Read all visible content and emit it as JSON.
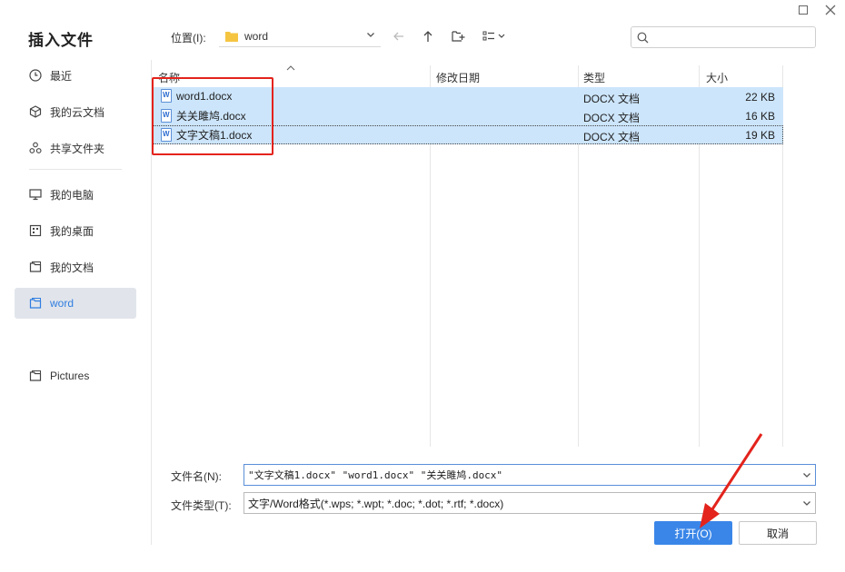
{
  "dialog": {
    "title": "插入文件"
  },
  "sidebar": {
    "items": [
      {
        "label": "最近",
        "icon": "clock-icon"
      },
      {
        "label": "我的云文档",
        "icon": "cloud-doc-icon"
      },
      {
        "label": "共享文件夹",
        "icon": "share-icon"
      },
      {
        "label": "我的电脑",
        "icon": "monitor-icon"
      },
      {
        "label": "我的桌面",
        "icon": "desktop-icon"
      },
      {
        "label": "我的文档",
        "icon": "folder-icon"
      },
      {
        "label": "word",
        "icon": "folder-icon"
      },
      {
        "label": "Pictures",
        "icon": "folder-icon"
      }
    ],
    "active_index": 6
  },
  "toolbar": {
    "location_label": "位置(I):",
    "location_value": "word",
    "search_placeholder": ""
  },
  "list": {
    "columns": [
      "名称",
      "修改日期",
      "类型",
      "大小"
    ],
    "rows": [
      {
        "name": "word1.docx",
        "type": "DOCX 文档",
        "size": "22 KB"
      },
      {
        "name": "关关雎鸠.docx",
        "type": "DOCX 文档",
        "size": "16 KB"
      },
      {
        "name": "文字文稿1.docx",
        "type": "DOCX 文档",
        "size": "19 KB"
      }
    ]
  },
  "bottom": {
    "filename_label": "文件名(N):",
    "filename_value": "\"文字文稿1.docx\" \"word1.docx\" \"关关雎鸠.docx\"",
    "filetype_label": "文件类型(T):",
    "filetype_value": "文字/Word格式(*.wps; *.wpt; *.doc; *.dot; *.rtf; *.docx)",
    "open_label": "打开(O)",
    "cancel_label": "取消"
  },
  "colors": {
    "accent": "#3a86e8",
    "selection": "#cce5fb",
    "annotation": "#e3231c"
  }
}
